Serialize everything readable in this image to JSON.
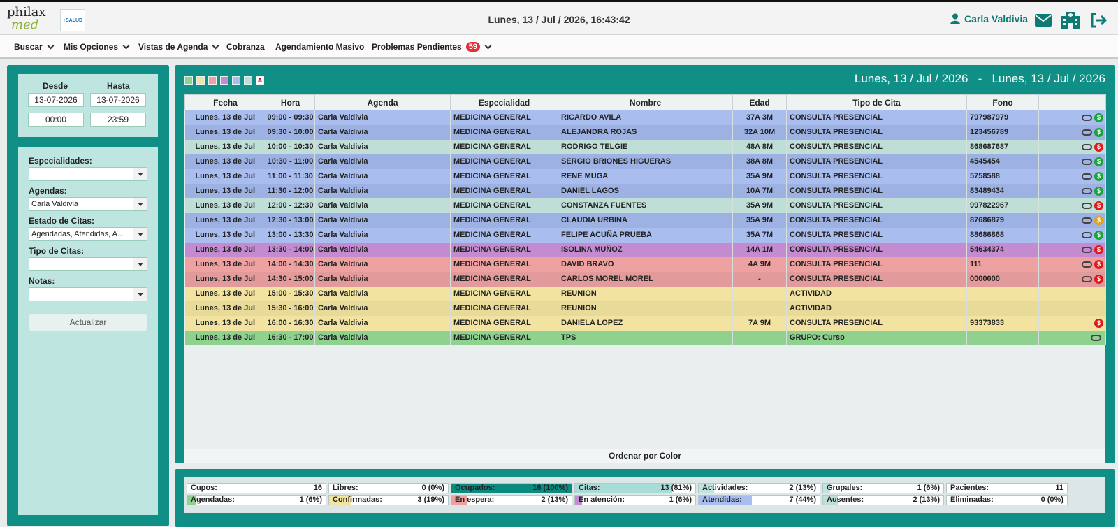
{
  "header": {
    "logo_line1": "philax",
    "logo_line2": "med",
    "salud_logo": "+SALUD",
    "datetime": "Lunes, 13 / Jul / 2026, 16:43:42",
    "user_name": "Carla Valdivia",
    "icons": [
      "user-icon",
      "mail-icon",
      "clinic-icon",
      "logout-icon"
    ]
  },
  "menu": {
    "items": [
      {
        "label": "Buscar",
        "dropdown": true
      },
      {
        "label": "Mis Opciones",
        "dropdown": true
      },
      {
        "label": "Vistas de Agenda",
        "dropdown": true
      },
      {
        "label": "Cobranza",
        "dropdown": false
      },
      {
        "label": "Agendamiento Masivo",
        "dropdown": false
      },
      {
        "label": "Problemas Pendientes",
        "dropdown": true,
        "badge": "59"
      }
    ]
  },
  "filters": {
    "desde_label": "Desde",
    "hasta_label": "Hasta",
    "desde_date": "13-07-2026",
    "hasta_date": "13-07-2026",
    "desde_time": "00:00",
    "hasta_time": "23:59",
    "especialidades_label": "Especialidades:",
    "especialidades_value": "",
    "agendas_label": "Agendas:",
    "agendas_value": "Carla Valdivia",
    "estado_label": "Estado de Citas:",
    "estado_value": "Agendadas, Atendidas, A...",
    "tipo_label": "Tipo de Citas:",
    "tipo_value": "",
    "notas_label": "Notas:",
    "notas_value": "",
    "actualizar_label": "Actualizar"
  },
  "legend": {
    "colors": [
      "#8fd18f",
      "#f2e4a0",
      "#eda1a1",
      "#c48bd1",
      "#a9bdef",
      "#bfded8"
    ],
    "letter": "A"
  },
  "range_label": "Lunes, 13 / Jul / 2026   -   Lunes, 13 / Jul / 2026",
  "table": {
    "columns": [
      "Fecha",
      "Hora",
      "Agenda",
      "Especialidad",
      "Nombre",
      "Edad",
      "Tipo de Cita",
      "Fono",
      ""
    ],
    "rows": [
      {
        "fecha": "Lunes, 13 de Jul",
        "hora": "09:00 - 09:30",
        "agenda": "Carla Valdivia",
        "esp": "MEDICINA GENERAL",
        "nombre": "RICARDO AVILA",
        "edad": "37A 3M",
        "tipo": "CONSULTA PRESENCIAL",
        "fono": "797987979",
        "bg": "#a9bdef",
        "link": true,
        "pay": "#1aa33a"
      },
      {
        "fecha": "Lunes, 13 de Jul",
        "hora": "09:30 - 10:00",
        "agenda": "Carla Valdivia",
        "esp": "MEDICINA GENERAL",
        "nombre": "ALEJANDRA ROJAS",
        "edad": "32A 10M",
        "tipo": "CONSULTA PRESENCIAL",
        "fono": "123456789",
        "bg": "#9db2e2",
        "link": true,
        "pay": "#1aa33a"
      },
      {
        "fecha": "Lunes, 13 de Jul",
        "hora": "10:00 - 10:30",
        "agenda": "Carla Valdivia",
        "esp": "MEDICINA GENERAL",
        "nombre": "RODRIGO TELGIE",
        "edad": "48A 8M",
        "tipo": "CONSULTA PRESENCIAL",
        "fono": "868687687",
        "bg": "#bfded8",
        "link": true,
        "pay": "#e01919"
      },
      {
        "fecha": "Lunes, 13 de Jul",
        "hora": "10:30 - 11:00",
        "agenda": "Carla Valdivia",
        "esp": "MEDICINA GENERAL",
        "nombre": "SERGIO BRIONES HIGUERAS",
        "edad": "38A 8M",
        "tipo": "CONSULTA PRESENCIAL",
        "fono": "4545454",
        "bg": "#9db2e2",
        "link": true,
        "pay": "#1aa33a"
      },
      {
        "fecha": "Lunes, 13 de Jul",
        "hora": "11:00 - 11:30",
        "agenda": "Carla Valdivia",
        "esp": "MEDICINA GENERAL",
        "nombre": "RENE MUGA",
        "edad": "35A 9M",
        "tipo": "CONSULTA PRESENCIAL",
        "fono": "5758588",
        "bg": "#a9bdef",
        "link": true,
        "pay": "#1aa33a"
      },
      {
        "fecha": "Lunes, 13 de Jul",
        "hora": "11:30 - 12:00",
        "agenda": "Carla Valdivia",
        "esp": "MEDICINA GENERAL",
        "nombre": "DANIEL LAGOS",
        "edad": "10A 7M",
        "tipo": "CONSULTA PRESENCIAL",
        "fono": "83489434",
        "bg": "#9db2e2",
        "link": true,
        "pay": "#1aa33a"
      },
      {
        "fecha": "Lunes, 13 de Jul",
        "hora": "12:00 - 12:30",
        "agenda": "Carla Valdivia",
        "esp": "MEDICINA GENERAL",
        "nombre": "CONSTANZA FUENTES",
        "edad": "35A 9M",
        "tipo": "CONSULTA PRESENCIAL",
        "fono": "997822967",
        "bg": "#bfded8",
        "link": true,
        "pay": "#e01919"
      },
      {
        "fecha": "Lunes, 13 de Jul",
        "hora": "12:30 - 13:00",
        "agenda": "Carla Valdivia",
        "esp": "MEDICINA GENERAL",
        "nombre": "CLAUDIA URBINA",
        "edad": "35A 9M",
        "tipo": "CONSULTA PRESENCIAL",
        "fono": "87686879",
        "bg": "#9db2e2",
        "link": true,
        "pay": "#e0a319"
      },
      {
        "fecha": "Lunes, 13 de Jul",
        "hora": "13:00 - 13:30",
        "agenda": "Carla Valdivia",
        "esp": "MEDICINA GENERAL",
        "nombre": "FELIPE ACUÑA PRUEBA",
        "edad": "35A 7M",
        "tipo": "CONSULTA PRESENCIAL",
        "fono": "88686868",
        "bg": "#a9bdef",
        "link": true,
        "pay": "#1aa33a"
      },
      {
        "fecha": "Lunes, 13 de Jul",
        "hora": "13:30 - 14:00",
        "agenda": "Carla Valdivia",
        "esp": "MEDICINA GENERAL",
        "nombre": "ISOLINA MUÑOZ",
        "edad": "14A 1M",
        "tipo": "CONSULTA PRESENCIAL",
        "fono": "54634374",
        "bg": "#c48bd1",
        "link": true,
        "pay": "#e01919"
      },
      {
        "fecha": "Lunes, 13 de Jul",
        "hora": "14:00 - 14:30",
        "agenda": "Carla Valdivia",
        "esp": "MEDICINA GENERAL",
        "nombre": "DAVID BRAVO",
        "edad": "4A 9M",
        "tipo": "CONSULTA PRESENCIAL",
        "fono": "111",
        "bg": "#eda1a1",
        "link": true,
        "pay": "#e01919"
      },
      {
        "fecha": "Lunes, 13 de Jul",
        "hora": "14:30 - 15:00",
        "agenda": "Carla Valdivia",
        "esp": "MEDICINA GENERAL",
        "nombre": "CARLOS MOREL MOREL",
        "edad": "-",
        "tipo": "CONSULTA PRESENCIAL",
        "fono": "0000000",
        "bg": "#e29a9a",
        "link": true,
        "pay": "#e01919"
      },
      {
        "fecha": "Lunes, 13 de Jul",
        "hora": "15:00 - 15:30",
        "agenda": "Carla Valdivia",
        "esp": "MEDICINA GENERAL",
        "nombre": "REUNION",
        "edad": "",
        "tipo": "ACTIVIDAD",
        "fono": "",
        "bg": "#f2e4a0",
        "link": false,
        "pay": ""
      },
      {
        "fecha": "Lunes, 13 de Jul",
        "hora": "15:30 - 16:00",
        "agenda": "Carla Valdivia",
        "esp": "MEDICINA GENERAL",
        "nombre": "REUNION",
        "edad": "",
        "tipo": "ACTIVIDAD",
        "fono": "",
        "bg": "#e8da98",
        "link": false,
        "pay": ""
      },
      {
        "fecha": "Lunes, 13 de Jul",
        "hora": "16:00 - 16:30",
        "agenda": "Carla Valdivia",
        "esp": "MEDICINA GENERAL",
        "nombre": "DANIELA LOPEZ",
        "edad": "7A 9M",
        "tipo": "CONSULTA PRESENCIAL",
        "fono": "93373833",
        "bg": "#f2e4a0",
        "link": false,
        "pay": "#e01919"
      },
      {
        "fecha": "Lunes, 13 de Jul",
        "hora": "16:30 - 17:00",
        "agenda": "Carla Valdivia",
        "esp": "MEDICINA GENERAL",
        "nombre": "TPS",
        "edad": "",
        "tipo": "GRUPO: Curso",
        "fono": "",
        "bg": "#8fd18f",
        "link": true,
        "pay": ""
      }
    ],
    "sort_label": "Ordenar por Color"
  },
  "stats": [
    {
      "label": "Cupos:",
      "value": "16",
      "fill": 0,
      "color": "#ffffff"
    },
    {
      "label": "Libres:",
      "value": "0 (0%)",
      "fill": 0,
      "color": "#ffffff"
    },
    {
      "label": "Ocupados:",
      "value": "16 (100%)",
      "fill": 1.0,
      "color": "#0d8a80"
    },
    {
      "label": "Citas:",
      "value": "13 (81%)",
      "fill": 0.81,
      "color": "#a8dcd6"
    },
    {
      "label": "Actividades:",
      "value": "2 (13%)",
      "fill": 0.13,
      "color": "#bfe5e1"
    },
    {
      "label": "Grupales:",
      "value": "1 (6%)",
      "fill": 0.06,
      "color": "#bfe5e1"
    },
    {
      "label": "Pacientes:",
      "value": "11",
      "fill": 0,
      "color": "#ffffff"
    },
    {
      "label": "Agendadas:",
      "value": "1 (6%)",
      "fill": 0.06,
      "color": "#8fd18f"
    },
    {
      "label": "Confirmadas:",
      "value": "3 (19%)",
      "fill": 0.19,
      "color": "#f2e4a0"
    },
    {
      "label": "En espera:",
      "value": "2 (13%)",
      "fill": 0.13,
      "color": "#eda1a1"
    },
    {
      "label": "En atención:",
      "value": "1 (6%)",
      "fill": 0.06,
      "color": "#c48bd1"
    },
    {
      "label": "Atendidas:",
      "value": "7 (44%)",
      "fill": 0.44,
      "color": "#a9bdef"
    },
    {
      "label": "Ausentes:",
      "value": "2 (13%)",
      "fill": 0.13,
      "color": "#bfded8"
    },
    {
      "label": "Eliminadas:",
      "value": "0 (0%)",
      "fill": 0,
      "color": "#ffffff"
    }
  ]
}
